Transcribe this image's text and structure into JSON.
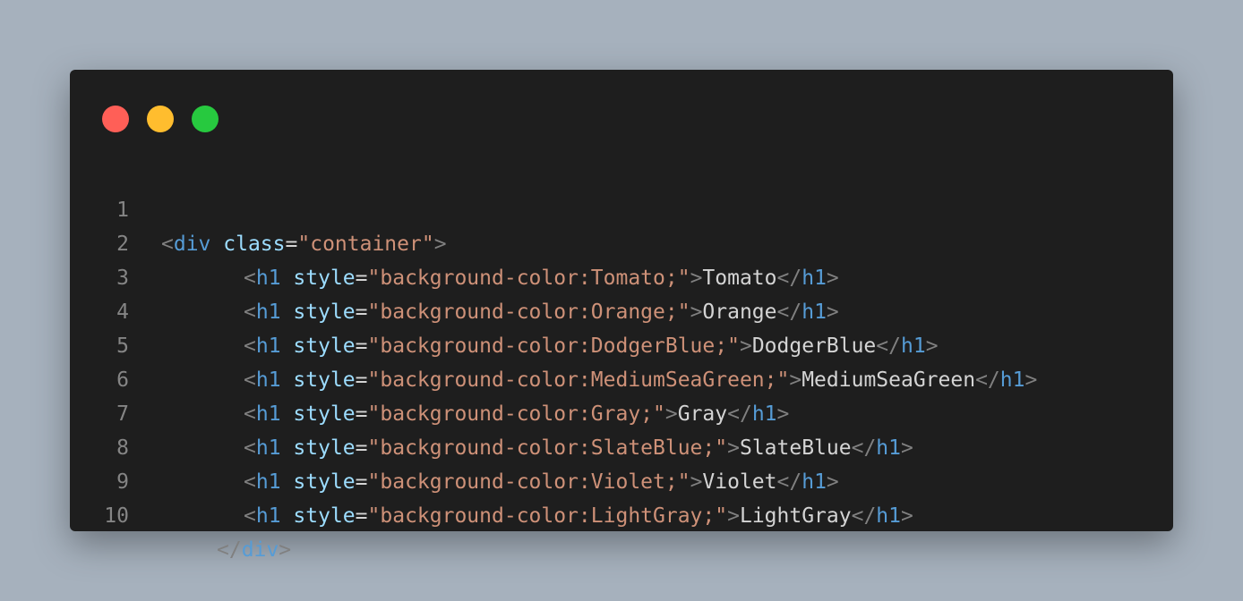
{
  "window": {
    "controls": [
      "close",
      "minimize",
      "maximize"
    ],
    "colors": {
      "background": "#1e1e1e",
      "close": "#ff5f57",
      "minimize": "#ffbd2e",
      "maximize": "#27c93f"
    }
  },
  "lines": [
    {
      "n": "1",
      "open_tag": "div",
      "attr": "class",
      "value": "\"container\"",
      "text": "",
      "close_tag": ""
    },
    {
      "n": "2",
      "open_tag": "h1",
      "attr": "style",
      "value": "\"background-color:Tomato;\"",
      "text": "Tomato",
      "close_tag": "h1"
    },
    {
      "n": "3",
      "open_tag": "h1",
      "attr": "style",
      "value": "\"background-color:Orange;\"",
      "text": "Orange",
      "close_tag": "h1"
    },
    {
      "n": "4",
      "open_tag": "h1",
      "attr": "style",
      "value": "\"background-color:DodgerBlue;\"",
      "text": "DodgerBlue",
      "close_tag": "h1"
    },
    {
      "n": "5",
      "open_tag": "h1",
      "attr": "style",
      "value": "\"background-color:MediumSeaGreen;\"",
      "text": "MediumSeaGreen",
      "close_tag": "h1"
    },
    {
      "n": "6",
      "open_tag": "h1",
      "attr": "style",
      "value": "\"background-color:Gray;\"",
      "text": "Gray",
      "close_tag": "h1"
    },
    {
      "n": "7",
      "open_tag": "h1",
      "attr": "style",
      "value": "\"background-color:SlateBlue;\"",
      "text": "SlateBlue",
      "close_tag": "h1"
    },
    {
      "n": "8",
      "open_tag": "h1",
      "attr": "style",
      "value": "\"background-color:Violet;\"",
      "text": "Violet",
      "close_tag": "h1"
    },
    {
      "n": "9",
      "open_tag": "h1",
      "attr": "style",
      "value": "\"background-color:LightGray;\"",
      "text": "LightGray",
      "close_tag": "h1"
    },
    {
      "n": "10",
      "open_tag": "",
      "attr": "",
      "value": "",
      "text": "",
      "close_tag": "div"
    }
  ]
}
